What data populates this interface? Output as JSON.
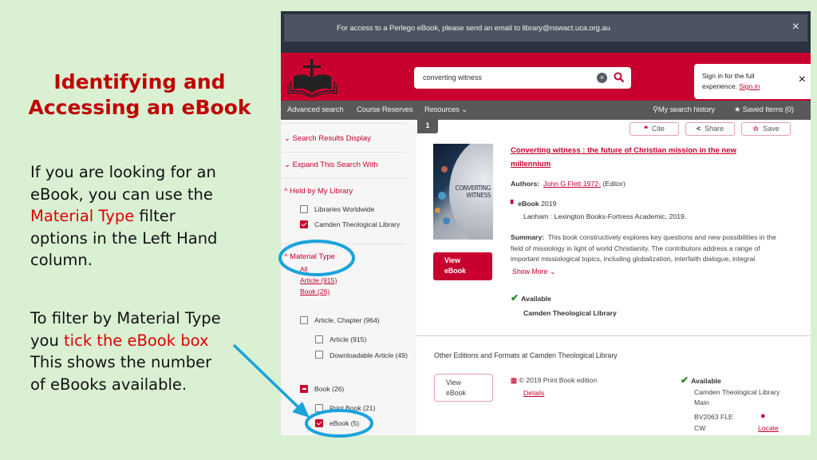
{
  "slide": {
    "title_line1": "Identifying and",
    "title_line2": "Accessing an eBook",
    "para1": {
      "line1": "If you are looking for an",
      "line2": "eBook, you can use the",
      "highlight": "Material Type",
      "line3_rest": " filter",
      "line4": "options in the Left Hand",
      "line5": "column."
    },
    "para2": {
      "line1": "To filter by Material Type",
      "line2_pre": "you ",
      "highlight": "tick the eBook box",
      "line3": "This shows the number",
      "line4": "of eBooks available."
    }
  },
  "banner": {
    "text": "For access to a Perlego eBook, please send an email to library@nswact.uca.org.au",
    "close_icon": "×"
  },
  "header": {
    "search_value": "converting witness",
    "clear_icon": "×",
    "search_icon": "⚲",
    "signin_text": "Sign in for the full experience.",
    "signin_link": "Sign in",
    "signin_close": "×"
  },
  "nav": {
    "advanced_search": "Advanced search",
    "course_reserves": "Course Reserves",
    "resources": "Resources",
    "my_search_history": "My search history",
    "saved_items": "Saved Items (0)"
  },
  "sidebar": {
    "search_results_display": "Search Results Display",
    "expand_search": "Expand This Search With",
    "held_by": "Held by My Library",
    "libraries_worldwide": "Libraries Worldwide",
    "camden": "Camden Theological Library",
    "material_type": "Material Type",
    "all_link": "All",
    "article_link": "Article (915)",
    "book_link": "Book (26)",
    "article_chapter": "Article, Chapter (964)",
    "article": "Article (915)",
    "downloadable_article": "Downloadable Article (49)",
    "book": "Book (26)",
    "print_book": "Print Book (21)",
    "ebook": "eBook (5)"
  },
  "result": {
    "number": "1",
    "cite": "Cite",
    "share": "Share",
    "save": "Save",
    "cover_title": "CONVERTING WITNESS",
    "view_ebook": "View eBook",
    "title": "Converting witness : the future of Christian mission in the new millennium",
    "authors_label": "Authors:",
    "author": "John G Flett 1972-",
    "author_role": "(Editor)",
    "format": "eBook",
    "year": "2019",
    "publisher": "Lanham : Lexington Books-Fortress Academic, 2019.",
    "summary_label": "Summary:",
    "summary": "This book constructively explores key questions and new possibilities in the field of missiology in light of world Christianity. The contributors address a range of important missiological topics, including globalization, interfaith dialogue, integral",
    "show_more": "Show More",
    "availability": "Available",
    "library": "Camden Theological Library"
  },
  "other_editions": {
    "heading": "Other Editions and Formats at Camden Theological Library",
    "view_ebook": "View eBook",
    "edition": "© 2019 Print Book edition",
    "details": "Details",
    "availability": "Available",
    "location_line1": "Camden Theological Library",
    "location_line2": "Main",
    "call_number_line1": "BV2063 FLE",
    "call_number_line2": "CW",
    "locate": "Locate"
  },
  "colors": {
    "brand_red": "#c8002f",
    "slide_title": "#c00000",
    "highlight_red": "#e00000",
    "annotation_blue": "#1aa3dc",
    "slide_bg": "#d9f0d3"
  }
}
